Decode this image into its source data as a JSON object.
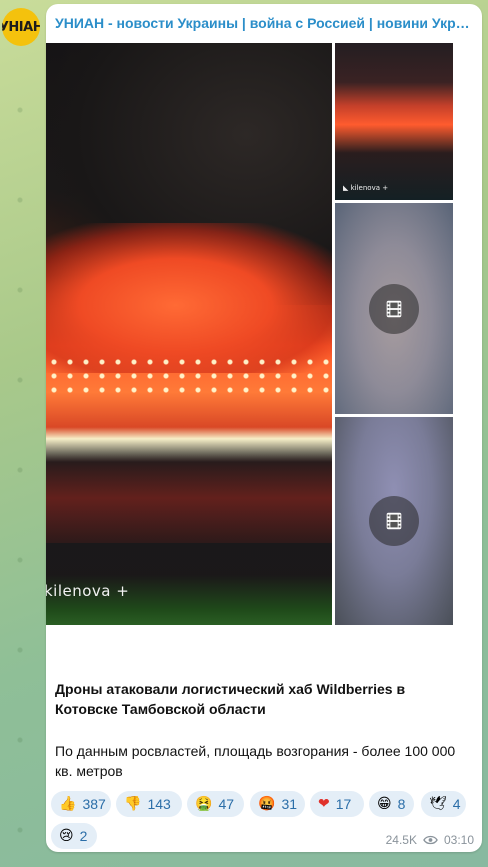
{
  "channel": {
    "avatar_text": "УНІАН",
    "title": "УНИАН - новости Украины | война с Россией | новини Україн..."
  },
  "media": {
    "main_watermark": "kilenova +",
    "side1_watermark": "◣ kilenova +",
    "video_icon": "film-icon"
  },
  "post": {
    "headline": "Дроны атаковали логистический хаб Wildberries в Котовске Тамбовской области",
    "body": "По данным росвластей, площадь возгорания - более 100 000 кв. метров"
  },
  "reactions": [
    {
      "emoji": "👍",
      "count": "387"
    },
    {
      "emoji": "👎",
      "count": "143"
    },
    {
      "emoji": "🤮",
      "count": "47"
    },
    {
      "emoji": "🤬",
      "count": "31"
    },
    {
      "emoji": "❤",
      "count": "17"
    },
    {
      "emoji": "😁",
      "count": "8"
    },
    {
      "emoji": "🕊",
      "count": "4"
    },
    {
      "emoji": "😢",
      "count": "2"
    }
  ],
  "meta": {
    "views": "24.5K",
    "time": "03:10"
  },
  "colors": {
    "link": "#2b8ec9",
    "reaction_bg": "#e4eef7",
    "reaction_text": "#2b6ea8"
  }
}
